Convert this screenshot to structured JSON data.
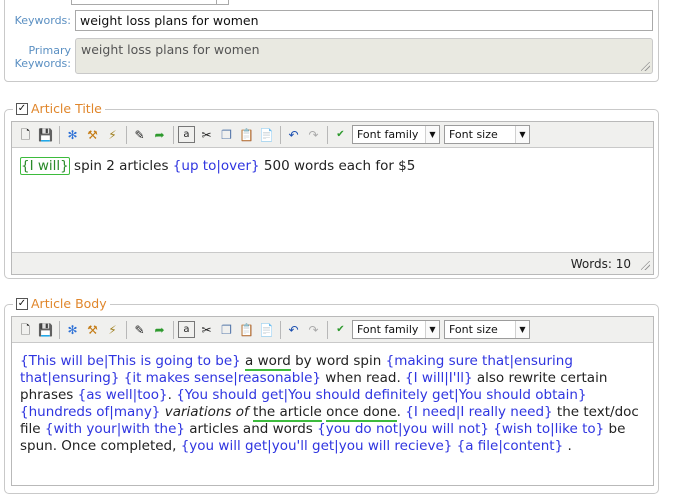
{
  "keywords": {
    "keywords_label": "Keywords:",
    "keywords_value": "weight loss plans for women",
    "primary_label_line1": "Primary",
    "primary_label_line2": "Keywords:",
    "primary_value": "weight loss plans for women"
  },
  "toolbar": {
    "font_family": "Font family",
    "font_size": "Font size"
  },
  "article_title": {
    "legend": "Article Title",
    "checked": true,
    "segments": [
      {
        "t": "{I will}",
        "style": "hl"
      },
      {
        "t": " spin 2 articles ",
        "style": ""
      },
      {
        "t": "{up to|over}",
        "style": "sp"
      },
      {
        "t": " 500 words each for $5",
        "style": ""
      }
    ],
    "word_count": "Words: 10"
  },
  "article_body": {
    "legend": "Article Body",
    "checked": true,
    "segments": [
      {
        "t": "{This will be|This is going to be}",
        "style": "sp"
      },
      {
        "t": " ",
        "style": ""
      },
      {
        "t": "a word",
        "style": "grn"
      },
      {
        "t": " by word spin ",
        "style": ""
      },
      {
        "t": "{making sure that|ensuring that|ensuring}",
        "style": "sp"
      },
      {
        "t": " ",
        "style": ""
      },
      {
        "t": "{it makes sense|reasonable}",
        "style": "sp"
      },
      {
        "t": " when read. ",
        "style": ""
      },
      {
        "t": "{I will|I'll}",
        "style": "sp"
      },
      {
        "t": " also rewrite certain phrases ",
        "style": ""
      },
      {
        "t": "{as well|too}",
        "style": "sp"
      },
      {
        "t": ". ",
        "style": ""
      },
      {
        "t": "{You should get|You should definitely get|You should obtain}",
        "style": "sp"
      },
      {
        "t": " ",
        "style": ""
      },
      {
        "t": "{hundreds of|many}",
        "style": "sp"
      },
      {
        "t": " ",
        "style": ""
      },
      {
        "t": "variations of",
        "style": "it"
      },
      {
        "t": " ",
        "style": ""
      },
      {
        "t": "the article",
        "style": "grn"
      },
      {
        "t": " ",
        "style": ""
      },
      {
        "t": "once done",
        "style": "grn"
      },
      {
        "t": ". ",
        "style": ""
      },
      {
        "t": "{I need|I really need}",
        "style": "sp"
      },
      {
        "t": " the text/doc file ",
        "style": ""
      },
      {
        "t": "{with your|with the}",
        "style": "sp"
      },
      {
        "t": " articles and words ",
        "style": ""
      },
      {
        "t": "{you do not|you will not}",
        "style": "sp"
      },
      {
        "t": " ",
        "style": ""
      },
      {
        "t": "{wish to|like to}",
        "style": "sp"
      },
      {
        "t": " be spun. Once completed, ",
        "style": ""
      },
      {
        "t": "{you will get|you'll get|you will recieve}",
        "style": "sp"
      },
      {
        "t": " ",
        "style": ""
      },
      {
        "t": "{a file|content}",
        "style": "sp"
      },
      {
        "t": " .",
        "style": ""
      }
    ]
  },
  "icons": [
    "new-document-icon",
    "save-icon",
    "spin-icon",
    "magic-wand-icon",
    "auto-spin-icon",
    "edit-icon",
    "redo-arrow-icon",
    "select-all-icon",
    "cut-icon",
    "copy-icon",
    "paste-icon",
    "paste-text-icon",
    "undo-icon",
    "redo-icon",
    "spellcheck-icon"
  ]
}
